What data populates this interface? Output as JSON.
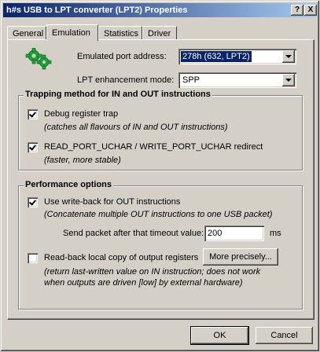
{
  "window": {
    "title": "h#s USB to LPT converter (LPT2) Properties"
  },
  "titlebar": {
    "help": "?",
    "close": "X"
  },
  "tabs": [
    {
      "label": "General"
    },
    {
      "label": "Emulation"
    },
    {
      "label": "Statistics"
    },
    {
      "label": "Driver"
    }
  ],
  "emulation": {
    "icon": "gears-icon",
    "port_address_label": "Emulated port address:",
    "port_address_value": "278h (632, LPT2)",
    "lpt_mode_label": "LPT enhancement mode:",
    "lpt_mode_value": "SPP"
  },
  "trapping": {
    "title": "Trapping method for IN and OUT instructions",
    "debug_trap": {
      "label": "Debug register trap",
      "checked": true,
      "desc": "(catches all flavours of IN and OUT instructions)"
    },
    "redirect": {
      "label": "READ_PORT_UCHAR / WRITE_PORT_UCHAR redirect",
      "checked": true,
      "desc": "(faster, more stable)"
    }
  },
  "performance": {
    "title": "Performance options",
    "writeback": {
      "label": "Use write-back for OUT instructions",
      "checked": true,
      "desc": "(Concatenate multiple OUT instructions to one USB packet)"
    },
    "timeout_label": "Send packet after that timeout value:",
    "timeout_value": "200",
    "timeout_unit": "ms",
    "readback": {
      "label": "Read-back local copy of output registers",
      "checked": false,
      "desc1": "(return last-written value on IN instruction; does not work",
      "desc2": "when outputs are driven [low] by external hardware)"
    },
    "more_button": "More precisely..."
  },
  "buttons": {
    "ok": "OK",
    "cancel": "Cancel"
  },
  "colors": {
    "face": "#d4d0c8",
    "title_start": "#0a246a",
    "title_end": "#a6caf0",
    "selection": "#0a246a"
  }
}
